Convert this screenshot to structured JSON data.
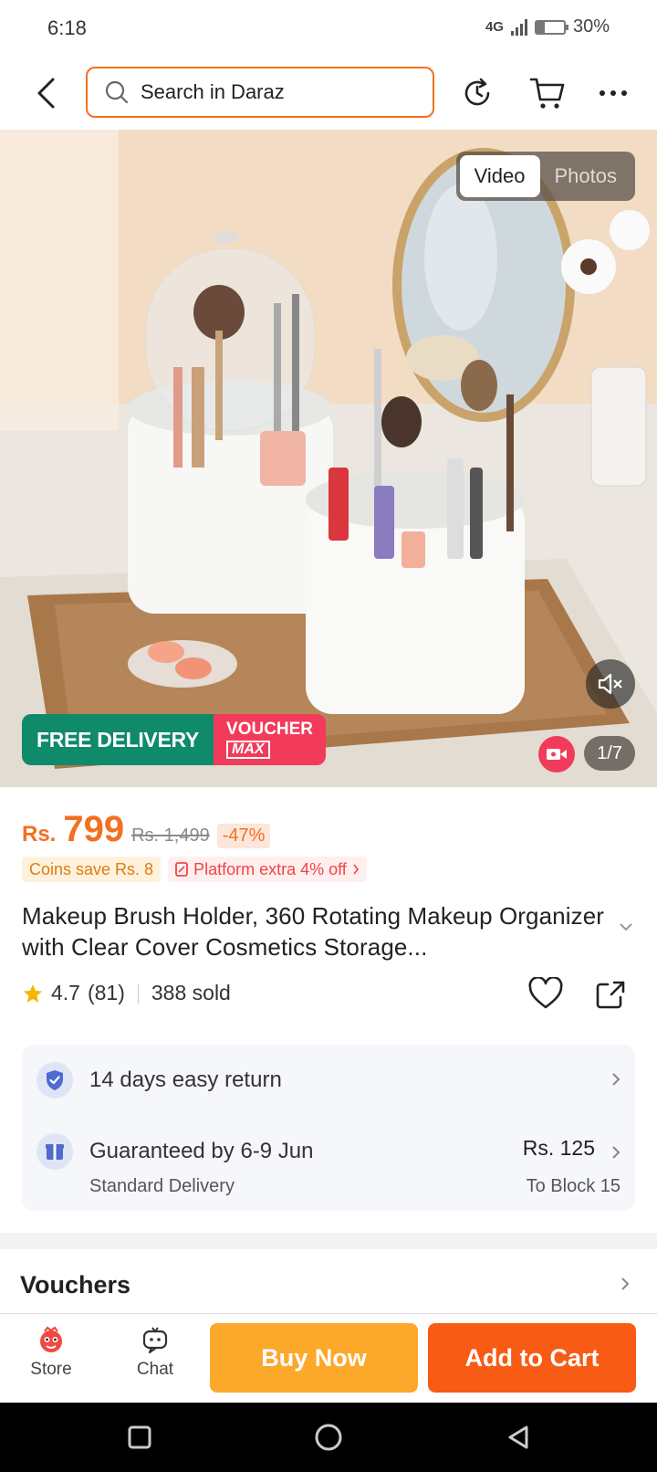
{
  "status": {
    "time": "6:18",
    "network": "4G",
    "battery": "30%",
    "battery_level": 0.3
  },
  "header": {
    "search_placeholder": "Search in Daraz",
    "icons": [
      "back-arrow-icon",
      "history-icon",
      "cart-icon",
      "more-icon"
    ]
  },
  "media": {
    "tabs": [
      "Video",
      "Photos"
    ],
    "active_tab": "Video",
    "pager": "1/7",
    "promo_free": "FREE DELIVERY",
    "promo_voucher": "VOUCHER",
    "promo_max": "MAX"
  },
  "product": {
    "currency": "Rs.",
    "price": "799",
    "old_price": "Rs. 1,499",
    "discount": "-47%",
    "coins_tag": "Coins save Rs. 8",
    "platform_tag": "Platform extra 4% off",
    "title": "Makeup Brush Holder, 360 Rotating Makeup Organizer with Clear Cover Cosmetics Storage...",
    "rating": "4.7",
    "rating_count": "(81)",
    "sold": "388 sold"
  },
  "service": {
    "return_text": "14 days easy return",
    "delivery_text": "Guaranteed by 6-9 Jun",
    "delivery_type": "Standard Delivery",
    "delivery_fee": "Rs. 125",
    "destination": "To Block 15"
  },
  "vouchers": {
    "label": "Vouchers"
  },
  "actionbar": {
    "store": "Store",
    "chat": "Chat",
    "buy_now": "Buy Now",
    "add_to_cart": "Add to Cart"
  },
  "colors": {
    "accent": "#f36f21",
    "buy_now": "#fca82a",
    "add_to_cart": "#f85b14",
    "free_delivery": "#0f8a6a",
    "voucher": "#f23b5b"
  }
}
